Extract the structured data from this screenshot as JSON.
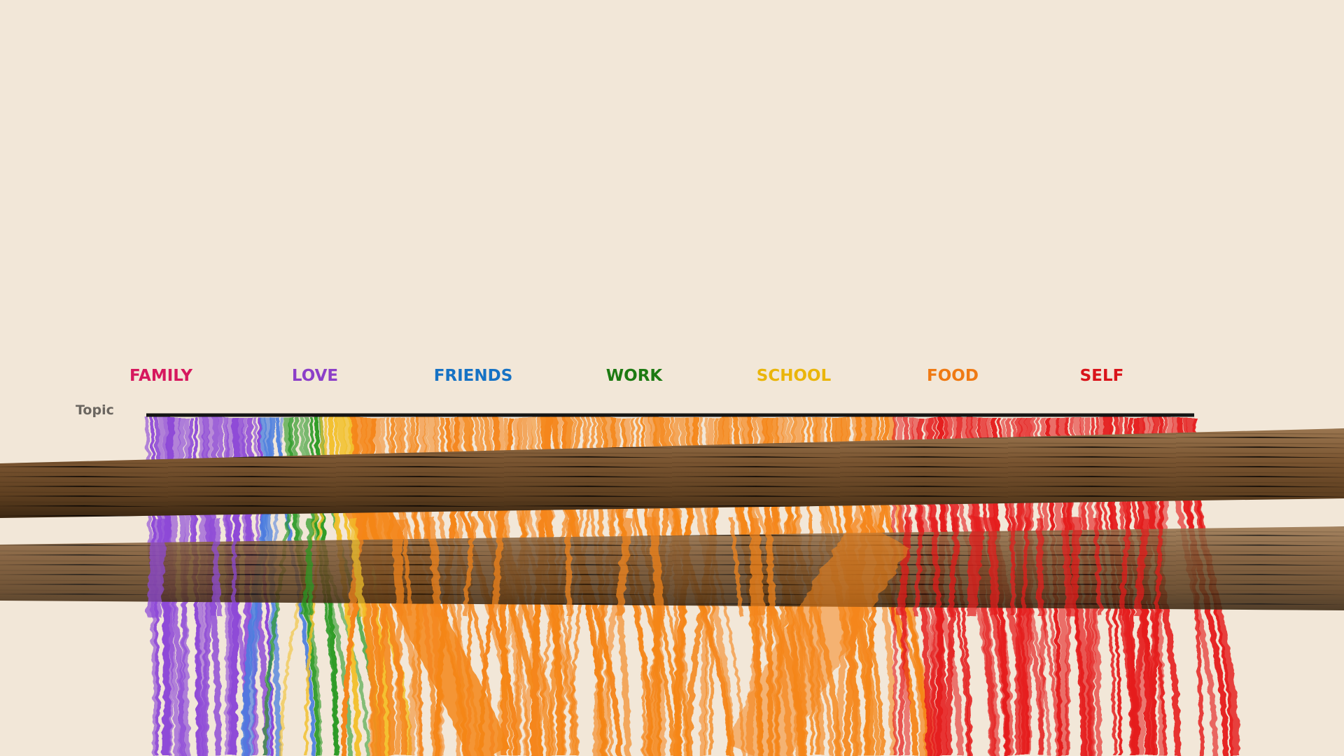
{
  "axis_label": "Topic",
  "topics": [
    {
      "label": "FAMILY",
      "color": "#d6185e"
    },
    {
      "label": "LOVE",
      "color": "#8c3fc8"
    },
    {
      "label": "FRIENDS",
      "color": "#1672c4"
    },
    {
      "label": "WORK",
      "color": "#1d7a12"
    },
    {
      "label": "SCHOOL",
      "color": "#eab50a"
    },
    {
      "label": "FOOD",
      "color": "#ef7a14"
    },
    {
      "label": "SELF",
      "color": "#d9141a"
    }
  ],
  "colors": {
    "background": "#f2e7d8",
    "axis_line": "#141414",
    "chopstick": "#7a5530",
    "noodle_purple": "#8e4ad8",
    "noodle_blue": "#4a7ee0",
    "noodle_green": "#2a9a24",
    "noodle_yellow": "#f2c02a",
    "noodle_orange": "#f5861a",
    "noodle_red": "#e51c1c"
  },
  "icons": [
    "chopstick-icon"
  ]
}
